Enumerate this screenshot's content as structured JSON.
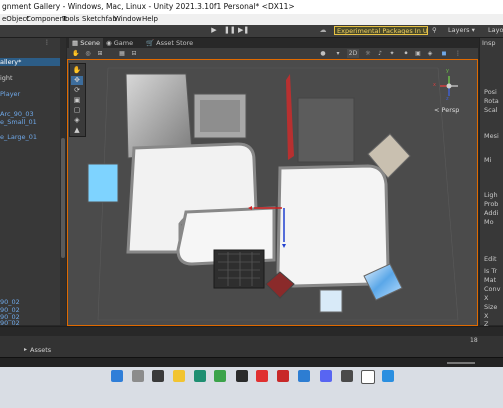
{
  "window": {
    "title": "gnment Gallery - Windows, Mac, Linux - Unity 2021.3.10f1 Personal* <DX11>"
  },
  "menu": [
    "eObject",
    "Component",
    "Tools",
    "Sketchfab",
    "Window",
    "Help"
  ],
  "toolbar": {
    "experimental_label": "Experimental Packages In Use ▾",
    "layers_label": "Layers ▾",
    "layout_label": "Layo"
  },
  "tabs": {
    "scene": "Scene",
    "game": "Game",
    "asset_store": "Asset Store",
    "inspector": "Insp"
  },
  "scene_toolbar": {
    "mode_2d": "2D"
  },
  "hierarchy": {
    "items": [
      {
        "label": "allery*",
        "style": "sel"
      },
      {
        "label": "ight",
        "style": "white"
      },
      {
        "label": "Player",
        "style": "blue"
      },
      {
        "label": "Arc_90_03",
        "style": "blue"
      },
      {
        "label": "e_Small_01",
        "style": "blue"
      },
      {
        "label": "e_Large_01",
        "style": "blue"
      },
      {
        "label": "90_02",
        "style": "blue"
      },
      {
        "label": "90_02",
        "style": "blue"
      },
      {
        "label": "90_02",
        "style": "blue"
      },
      {
        "label": "90_02",
        "style": "blue"
      }
    ]
  },
  "scene": {
    "persp_label": "< Persp",
    "axis_y": "y",
    "axis_x": "x",
    "axis_z": "z"
  },
  "inspector": {
    "items": [
      "Posi",
      "Rota",
      "Scal",
      "Mesi",
      "Mi",
      "Ligh",
      "Prob",
      "Addi",
      "Mo",
      "Edit",
      "Is Tr",
      "Mat",
      "Conv",
      "X",
      "Size",
      "X",
      "Z"
    ]
  },
  "project": {
    "assets_label": "Assets",
    "count_label": "18"
  },
  "colors": {
    "accent_orange": "#e06a00",
    "experimental_yellow": "#e8c244",
    "selection_blue": "#2c5d87"
  }
}
